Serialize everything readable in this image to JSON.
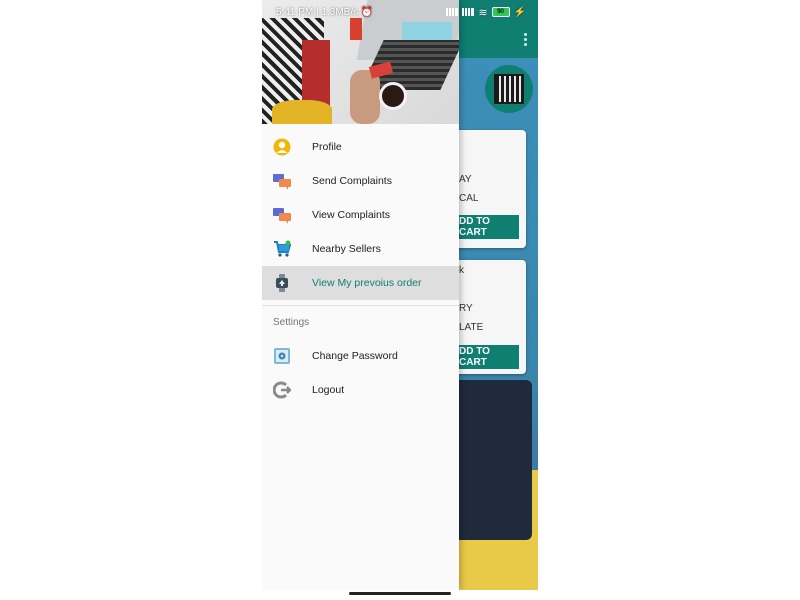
{
  "status_bar": {
    "time": "5:41 PM",
    "speed": "1.3MB/s",
    "battery": "90"
  },
  "drawer": {
    "menu": [
      {
        "label": "Profile",
        "icon": "profile-icon"
      },
      {
        "label": "Send Complaints",
        "icon": "chat-bubbles-icon"
      },
      {
        "label": "View Complaints",
        "icon": "chat-bubbles-icon"
      },
      {
        "label": "Nearby Sellers",
        "icon": "shopping-cart-icon"
      },
      {
        "label": "View My prevoius order",
        "icon": "watch-icon",
        "active": true
      }
    ],
    "settings_title": "Settings",
    "settings": [
      {
        "label": "Change Password",
        "icon": "safe-icon"
      },
      {
        "label": "Logout",
        "icon": "logout-icon"
      }
    ]
  },
  "app": {
    "card1": {
      "line1": "AY",
      "line2": "CAL",
      "button": "DD TO CART"
    },
    "card2": {
      "line0": "k",
      "line1": "RY",
      "line2": "LATE",
      "button": "DD TO CART"
    }
  },
  "colors": {
    "primary": "#0f7f72",
    "drawer_bg": "#fafafa",
    "active_bg": "#dedede"
  }
}
